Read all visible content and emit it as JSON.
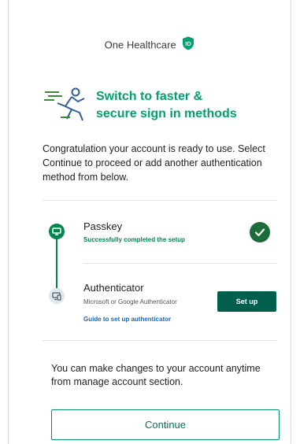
{
  "brand": {
    "name": "One Healthcare",
    "shield_letter": "ID",
    "icon": "shield-id-icon",
    "color": "#00a071"
  },
  "hero": {
    "title_line1": "Switch to faster &",
    "title_line2": "secure sign in methods",
    "icon": "runner-icon",
    "accent_color": "#00a071"
  },
  "intro": {
    "text": "Congratulation your account is ready to use. Select Continue to proceed or add another authentication method from below."
  },
  "steps": [
    {
      "title": "Passkey",
      "subtitle": "Successfully completed the setup",
      "status": "completed",
      "icon": "passkey-monitor-icon",
      "status_icon": "check-circle-icon"
    },
    {
      "title": "Authenticator",
      "subtitle": "Microsoft or Google Authenticator",
      "link": "Guide to set up authenticator",
      "status": "pending",
      "icon": "authenticator-device-icon",
      "action_label": "Set up"
    }
  ],
  "footer": {
    "note": "You can make changes to your account anytime from manage account section.",
    "continue_label": "Continue"
  },
  "colors": {
    "success_green": "#00874f",
    "primary_dark_green": "#005e4c",
    "link_blue": "#1a67b3"
  }
}
